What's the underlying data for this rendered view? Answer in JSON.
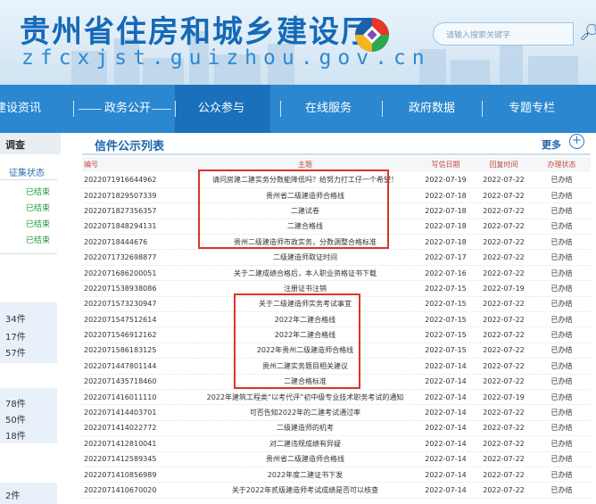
{
  "header": {
    "title_cn": "贵州省住房和城乡建设厅",
    "title_en": "zfcxjst.guizhou.gov.cn",
    "search_placeholder": "请输入搜索关键字"
  },
  "nav": {
    "items": [
      "建设资讯",
      "政务公开",
      "公众参与",
      "在线服务",
      "政府数据",
      "专题专栏"
    ]
  },
  "sidebar": {
    "head": "调查",
    "sub": "征集状态",
    "statuses": [
      "已结束",
      "已结束",
      "已结束",
      "已结束"
    ],
    "counts_a": [
      "34件",
      "17件",
      "57件"
    ],
    "counts_b": [
      "78件",
      "50件",
      "18件"
    ],
    "count_c": "2件"
  },
  "main": {
    "title": "信件公示列表",
    "more": "更多",
    "columns": [
      "编号",
      "主题",
      "写信日期",
      "回复时间",
      "办理状态"
    ],
    "rows": [
      [
        "2022071916644962",
        "请问房建二建实务分数能降低吗？给努力打工仔一个希望！",
        "2022-07-19",
        "2022-07-22",
        "已办结"
      ],
      [
        "2022071829507339",
        "贵州省二级建造师合格线",
        "2022-07-18",
        "2022-07-22",
        "已办结"
      ],
      [
        "2022071827356357",
        "二建试卷",
        "2022-07-18",
        "2022-07-22",
        "已办结"
      ],
      [
        "2022071848294131",
        "二建合格线",
        "2022-07-18",
        "2022-07-22",
        "已办结"
      ],
      [
        "20220718444676",
        "贵州二级建造师市政实务，分数调整合格标准",
        "2022-07-18",
        "2022-07-22",
        "已办结"
      ],
      [
        "2022071732698877",
        "二级建造师取证时间",
        "2022-07-17",
        "2022-07-22",
        "已办结"
      ],
      [
        "2022071686200051",
        "关于二建成绩合格后，本人职业资格证书下载",
        "2022-07-16",
        "2022-07-22",
        "已办结"
      ],
      [
        "2022071538938086",
        "注册证书注销",
        "2022-07-15",
        "2022-07-19",
        "已办结"
      ],
      [
        "2022071573230947",
        "关于二级建造师实务考试事宜",
        "2022-07-15",
        "2022-07-22",
        "已办结"
      ],
      [
        "2022071547512614",
        "2022年二建合格线",
        "2022-07-15",
        "2022-07-22",
        "已办结"
      ],
      [
        "2022071546912162",
        "2022年二建合格线",
        "2022-07-15",
        "2022-07-22",
        "已办结"
      ],
      [
        "2022071586183125",
        "2022年贵州二级建造师合格线",
        "2022-07-15",
        "2022-07-22",
        "已办结"
      ],
      [
        "2022071447801144",
        "贵州二建实务题目相关建议",
        "2022-07-14",
        "2022-07-22",
        "已办结"
      ],
      [
        "2022071435718460",
        "二建合格标准",
        "2022-07-14",
        "2022-07-22",
        "已办结"
      ],
      [
        "2022071416011110",
        "2022年建筑工程类“以考代评”初中级专业技术职务考试的通知",
        "2022-07-14",
        "2022-07-19",
        "已办结"
      ],
      [
        "2022071414403701",
        "可否告知2022年的二建考试通过率",
        "2022-07-14",
        "2022-07-22",
        "已办结"
      ],
      [
        "2022071414022772",
        "二级建造师的机考",
        "2022-07-14",
        "2022-07-22",
        "已办结"
      ],
      [
        "2022071412810041",
        "对二建违规成绩有异疑",
        "2022-07-14",
        "2022-07-22",
        "已办结"
      ],
      [
        "2022071412589345",
        "贵州省二级建造师合格线",
        "2022-07-14",
        "2022-07-22",
        "已办结"
      ],
      [
        "2022071410856989",
        "2022年度二建证书下发",
        "2022-07-14",
        "2022-07-22",
        "已办结"
      ],
      [
        "2022071410670020",
        "关于2022年贰级建造师考试成绩是否可以核查",
        "2022-07-14",
        "2022-07-22",
        "已办结"
      ]
    ]
  },
  "colors": {
    "brand_blue": "#2a87d0",
    "highlight_red": "#e0322b",
    "status_green": "#1a9a3a"
  }
}
